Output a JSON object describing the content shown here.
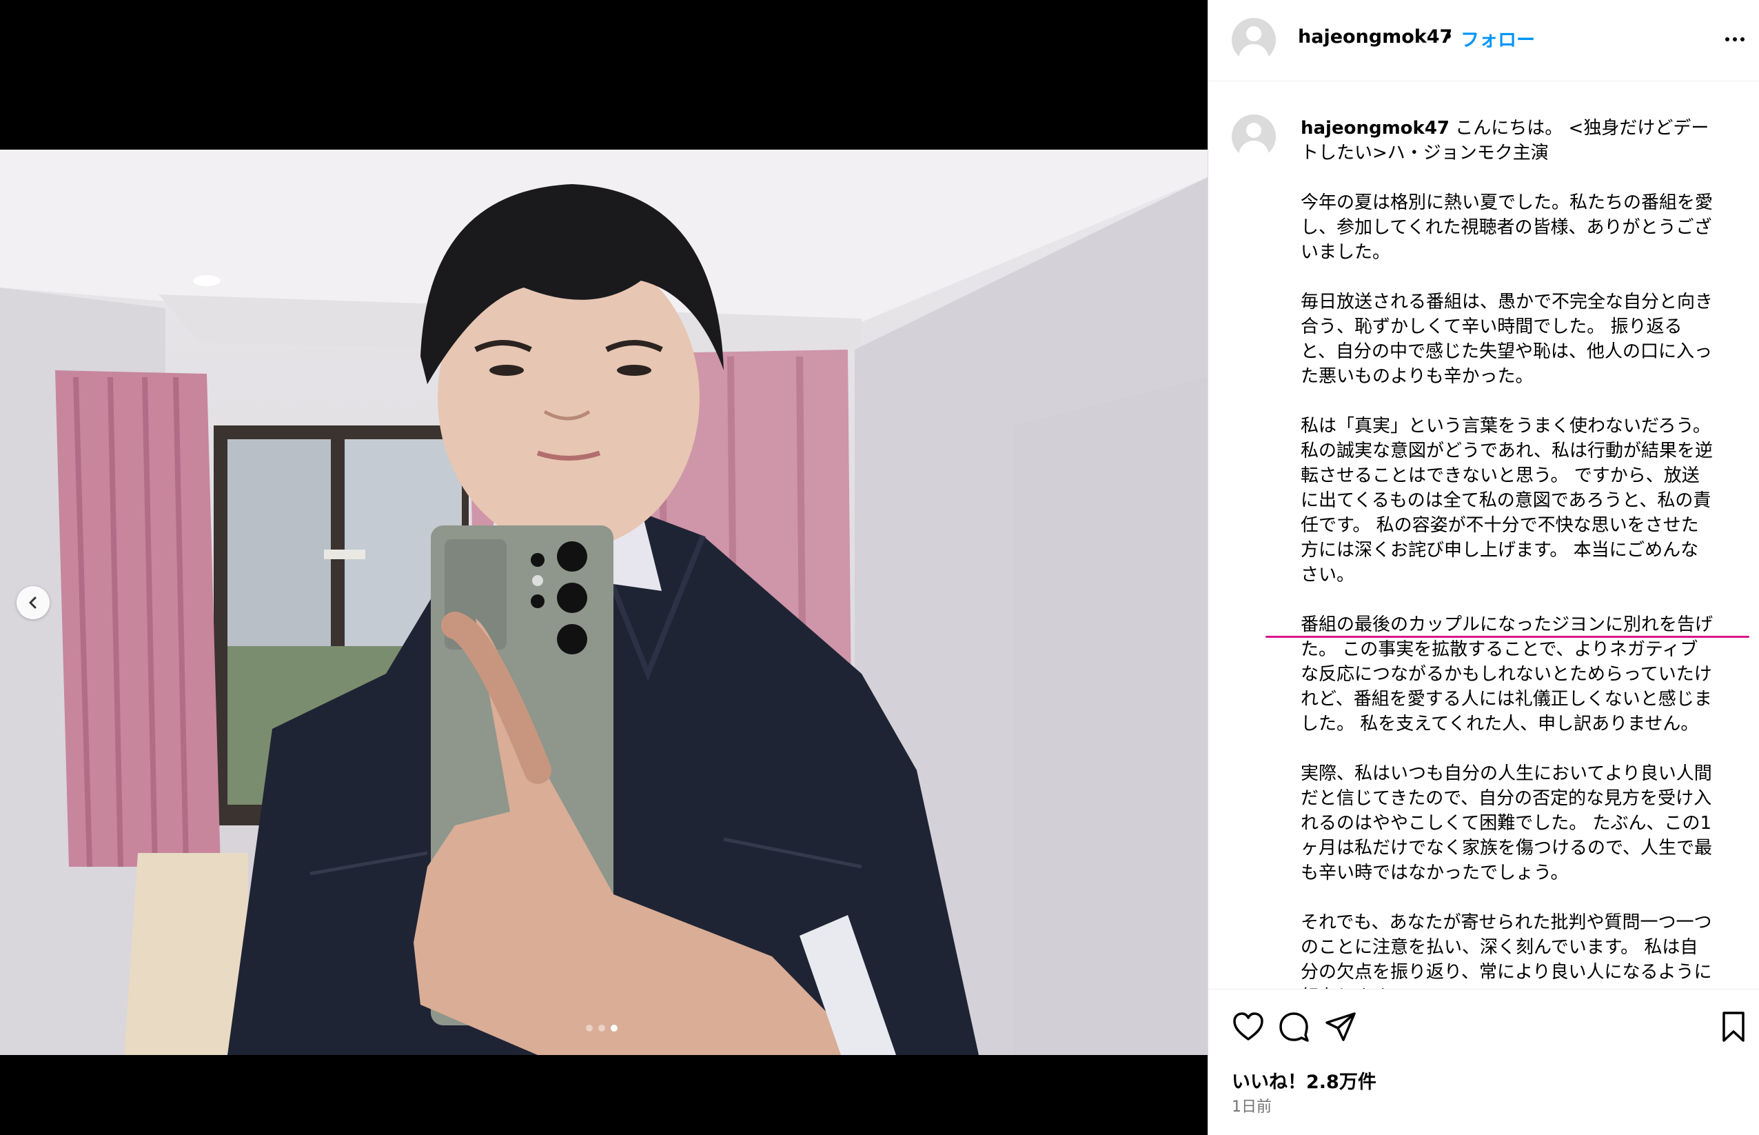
{
  "post": {
    "username": "hajeongmok47",
    "separator": "•",
    "follow_label": "フォロー",
    "more_icon": "more-icon",
    "carousel": {
      "total_slides": 3,
      "active_slide": 3
    }
  },
  "caption": {
    "username": "hajeongmok47",
    "intro": "こんにちは。 <独身だけどデートしたい>ハ・ジョンモク主演",
    "paragraphs": [
      "今年の夏は格別に熱い夏でした。私たちの番組を愛し、参加してくれた視聴者の皆様、ありがとうございました。",
      "毎日放送される番組は、愚かで不完全な自分と向き合う、恥ずかしくて辛い時間でした。 振り返ると、自分の中で感じた失望や恥は、他人の口に入った悪いものよりも辛かった。",
      "私は「真実」という言葉をうまく使わないだろう。私の誠実な意図がどうであれ、私は行動が結果を逆転させることはできないと思う。 ですから、放送に出てくるものは全て私の意図であろうと、私の責任です。 私の容姿が不十分で不快な思いをさせた方には深くお詫び申し上げます。 本当にごめんなさい。",
      "番組の最後のカップルになったジヨンに別れを告げた。 この事実を拡散することで、よりネガティブな反応につながるかもしれないとためらっていたけれど、番組を愛する人には礼儀正しくないと感じました。 私を支えてくれた人、申し訳ありません。",
      "実際、私はいつも自分の人生においてより良い人間だと信じてきたので、自分の否定的な見方を受け入れるのはややこしくて困難でした。 たぶん、この1ヶ月は私だけでなく家族を傷つけるので、人生で最も辛い時ではなかったでしょう。",
      "それでも、あなたが寄せられた批判や質問一つ一つのことに注意を払い、深く刻んでいます。 私は自分の欠点を振り返り、常により良い人になるように努力します。"
    ],
    "highlight_color": "#d8178a"
  },
  "actions": {
    "like_icon": "heart-icon",
    "comment_icon": "comment-icon",
    "share_icon": "share-icon",
    "save_icon": "bookmark-icon",
    "likes_text": "いいね！2.8万件",
    "time_text": "1日前"
  },
  "colors": {
    "follow": "#0095f6",
    "muted": "#737373",
    "highlight": "#d8178a"
  }
}
